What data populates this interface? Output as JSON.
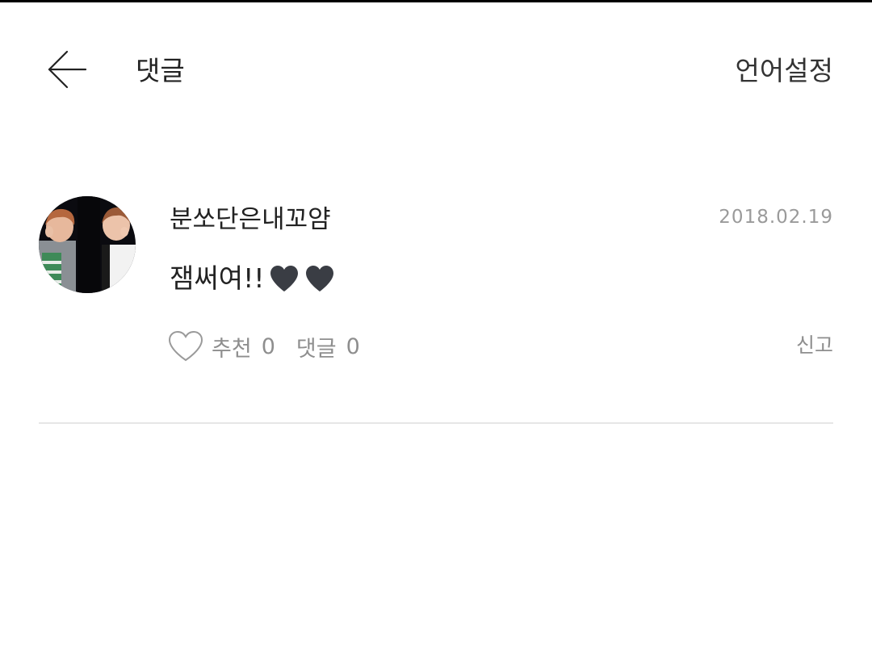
{
  "header": {
    "title": "댓글",
    "language_settings_label": "언어설정",
    "back_icon": "arrow-left-icon"
  },
  "comment": {
    "username": "분쏘단은내꼬얌",
    "date": "2018.02.19",
    "text": "잼써여!!",
    "emoji": [
      "♥",
      "♥"
    ],
    "like_label": "추천",
    "like_count": "0",
    "reply_label": "댓글",
    "reply_count": "0",
    "report_label": "신고",
    "like_icon": "heart-outline-icon"
  },
  "colors": {
    "text_primary": "#222222",
    "text_secondary": "#8e8e8e",
    "divider": "#e6e6e6",
    "emoji_heart": "#3a3d44"
  }
}
